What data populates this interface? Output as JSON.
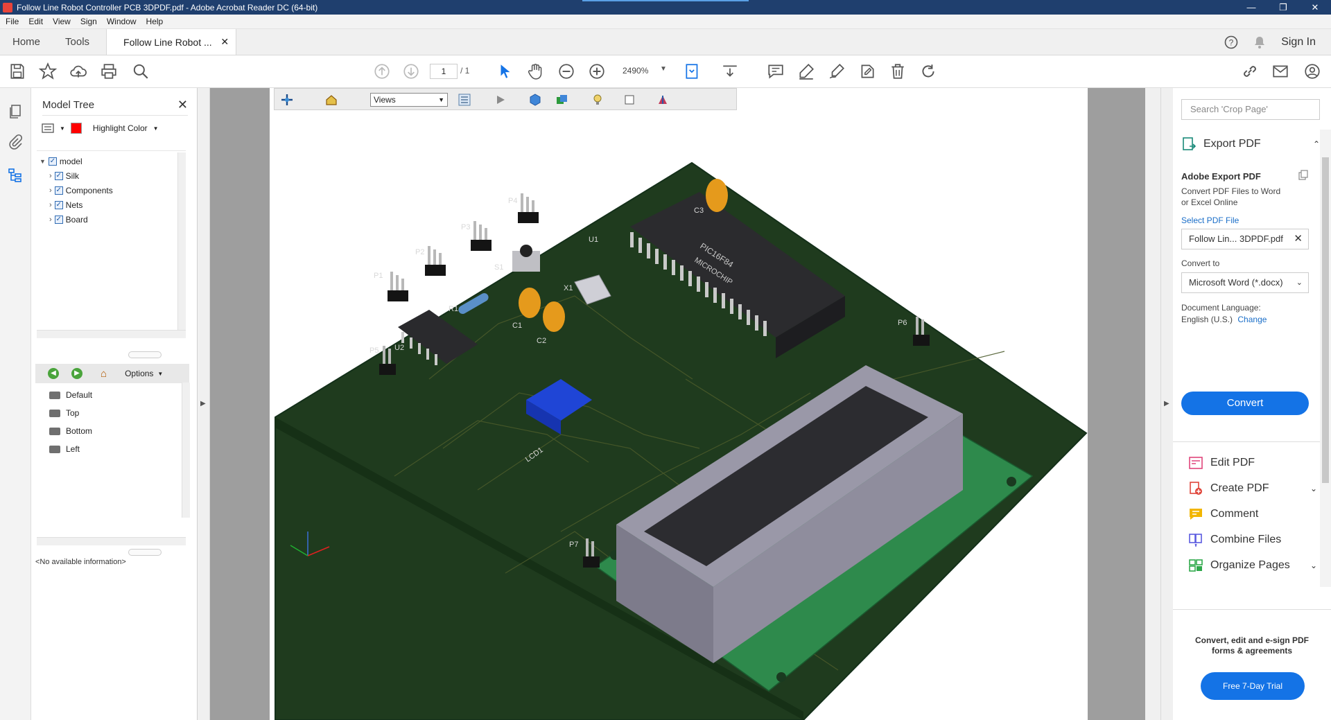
{
  "window": {
    "title": "Follow Line Robot Controller PCB  3DPDF.pdf - Adobe Acrobat Reader DC (64-bit)"
  },
  "menu": [
    "File",
    "Edit",
    "View",
    "Sign",
    "Window",
    "Help"
  ],
  "tabs": {
    "home": "Home",
    "tools": "Tools",
    "doc": "Follow Line Robot ...",
    "sign_in": "Sign In"
  },
  "toolbar": {
    "page_current": "1",
    "page_total": "/ 1",
    "zoom": "2490%"
  },
  "model_tree": {
    "title": "Model Tree",
    "highlight_label": "Highlight Color",
    "highlight_color": "#ff0000",
    "root": "model",
    "children": [
      "Silk",
      "Components",
      "Nets",
      "Board"
    ],
    "options_label": "Options",
    "views": [
      "Default",
      "Top",
      "Bottom",
      "Left"
    ],
    "info": "<No available information>"
  },
  "viewer3d": {
    "views_select": "Views",
    "labels": {
      "u1": "U1",
      "u2": "U2",
      "s1": "S1",
      "x1": "X1",
      "r1": "R1",
      "c1": "C1",
      "c2": "C2",
      "c3": "C3",
      "lcd1": "LCD1",
      "p1": "P1",
      "p2": "P2",
      "p3": "P3",
      "p4": "P4",
      "p5": "P5",
      "p6": "P6",
      "p7": "P7",
      "chip_text_1": "PIC16F84",
      "chip_text_2": "MICROCHIP"
    }
  },
  "right_pane": {
    "search_placeholder": "Search 'Crop Page'",
    "export_header": "Export PDF",
    "export_title": "Adobe Export PDF",
    "export_desc_1": "Convert PDF Files to Word",
    "export_desc_2": "or Excel Online",
    "select_file": "Select PDF File",
    "file_name": "Follow Lin... 3DPDF.pdf",
    "convert_to_label": "Convert to",
    "convert_to_value": "Microsoft Word (*.docx)",
    "doc_lang_label": "Document Language:",
    "doc_lang_value": "English (U.S.)",
    "change_link": "Change",
    "convert_button": "Convert",
    "tools": [
      "Edit PDF",
      "Create PDF",
      "Comment",
      "Combine Files",
      "Organize Pages"
    ],
    "trial_note_1": "Convert, edit and e-sign PDF",
    "trial_note_2": "forms & agreements",
    "trial_button": "Free 7-Day Trial"
  },
  "colors": {
    "accent": "#1473e6",
    "titlebar": "#1f3f6e",
    "board": "#1e3a1c"
  }
}
